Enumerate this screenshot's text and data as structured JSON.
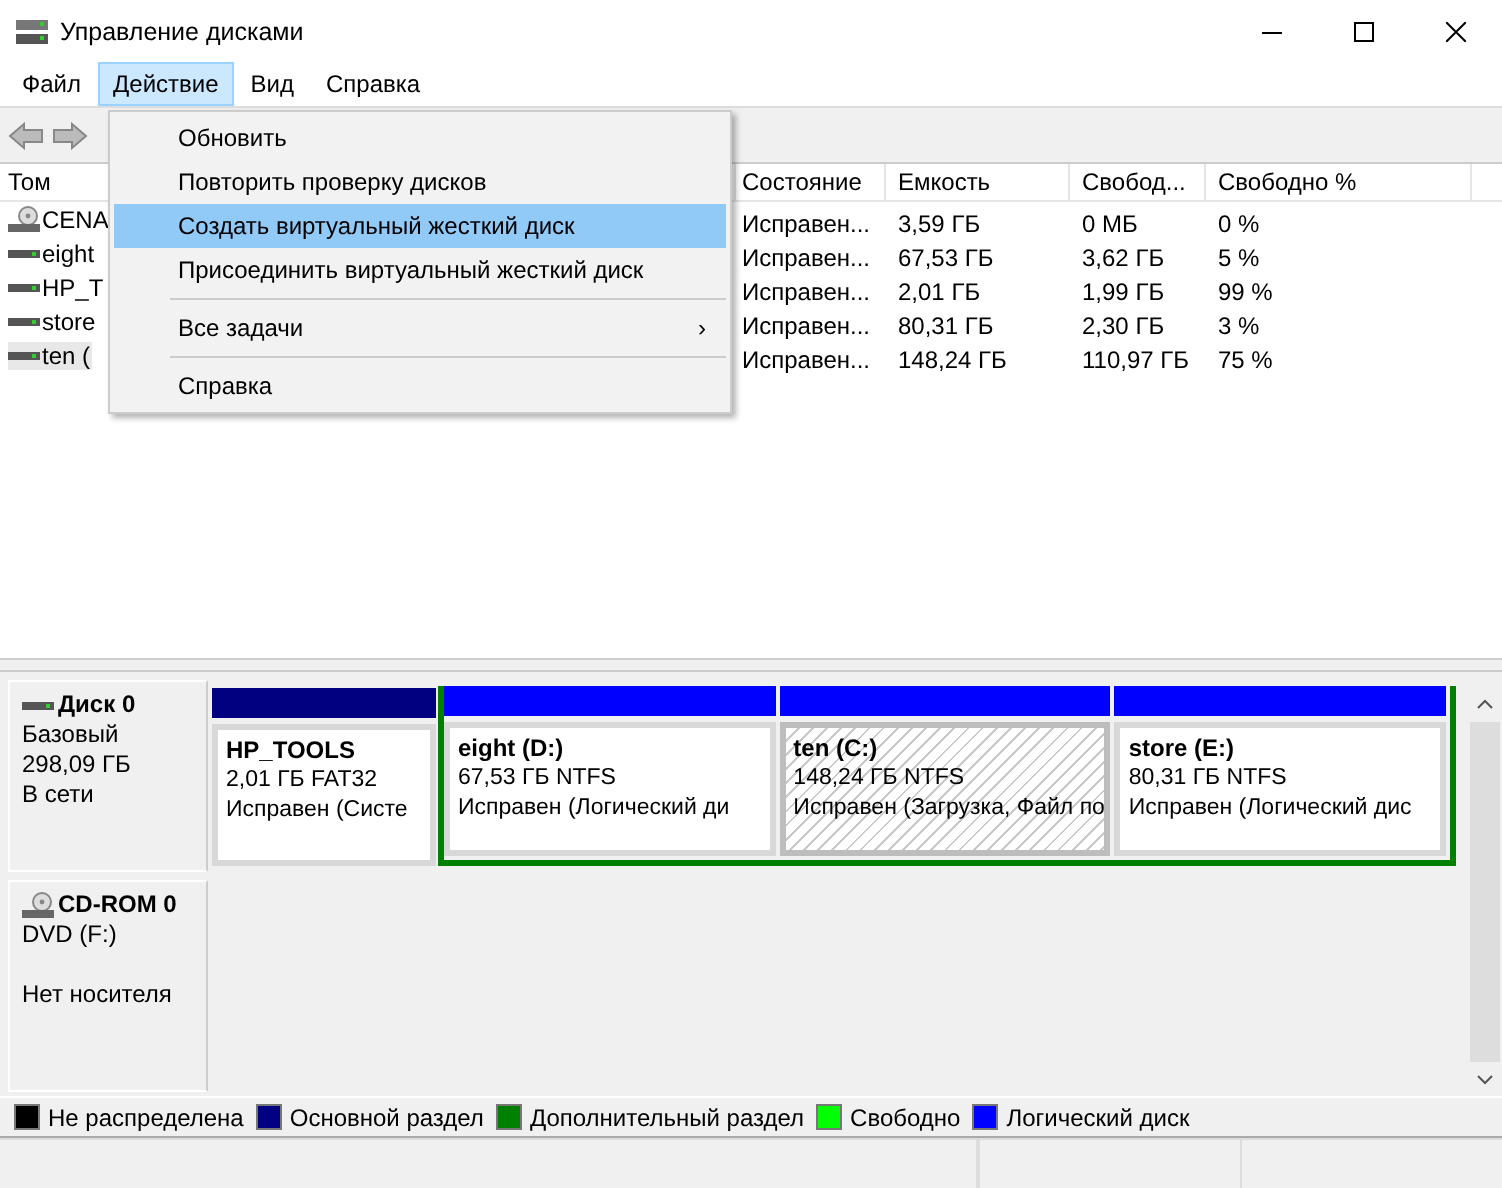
{
  "window": {
    "title": "Управление дисками"
  },
  "menubar": [
    {
      "label": "Файл",
      "selected": false
    },
    {
      "label": "Действие",
      "selected": true
    },
    {
      "label": "Вид",
      "selected": false
    },
    {
      "label": "Справка",
      "selected": false
    }
  ],
  "dropdown": {
    "groups": [
      [
        {
          "label": "Обновить",
          "selected": false
        },
        {
          "label": "Повторить проверку дисков",
          "selected": false
        },
        {
          "label": "Создать виртуальный жесткий диск",
          "selected": true
        },
        {
          "label": "Присоединить виртуальный жесткий диск",
          "selected": false
        }
      ],
      [
        {
          "label": "Все задачи",
          "selected": false,
          "arrow": "›"
        }
      ],
      [
        {
          "label": "Справка",
          "selected": false
        }
      ]
    ]
  },
  "volume_table": {
    "columns": [
      "Том",
      "Состояние",
      "Емкость",
      "Свобод...",
      "Свободно %"
    ],
    "rows": [
      {
        "kind": "cd",
        "name": "CENA",
        "status": "Исправен...",
        "capacity": "3,59 ГБ",
        "free": "0 МБ",
        "free_pct": "0 %",
        "selected": false
      },
      {
        "kind": "drive",
        "name": "eight",
        "status": "Исправен...",
        "capacity": "67,53 ГБ",
        "free": "3,62 ГБ",
        "free_pct": "5 %",
        "selected": false
      },
      {
        "kind": "drive",
        "name": "HP_T",
        "status": "Исправен...",
        "capacity": "2,01 ГБ",
        "free": "1,99 ГБ",
        "free_pct": "99 %",
        "selected": false
      },
      {
        "kind": "drive",
        "name": "store",
        "status": "Исправен...",
        "capacity": "80,31 ГБ",
        "free": "2,30 ГБ",
        "free_pct": "3 %",
        "selected": false
      },
      {
        "kind": "drive",
        "name": "ten (",
        "status": "Исправен...",
        "capacity": "148,24 ГБ",
        "free": "110,97 ГБ",
        "free_pct": "75 %",
        "selected": true
      }
    ]
  },
  "disks": [
    {
      "kind": "disk",
      "name": "Диск 0",
      "lines": [
        "Базовый",
        "298,09 ГБ",
        "В сети"
      ],
      "partitions": [
        {
          "kind": "primary",
          "name": "HP_TOOLS",
          "info": "2,01 ГБ FAT32",
          "status": "Исправен (Систе",
          "selected": false
        },
        {
          "kind": "extended",
          "children": [
            {
              "kind": "logical",
              "name": "eight  (D:)",
              "info": "67,53 ГБ NTFS",
              "status": "Исправен (Логический ди",
              "selected": false
            },
            {
              "kind": "logical",
              "name": "ten  (C:)",
              "info": "148,24 ГБ NTFS",
              "status": "Исправен (Загрузка, Файл по",
              "selected": true
            },
            {
              "kind": "logical",
              "name": "store  (E:)",
              "info": "80,31 ГБ NTFS",
              "status": "Исправен (Логический дис",
              "selected": false
            }
          ]
        }
      ]
    },
    {
      "kind": "cdrom",
      "name": "CD-ROM 0",
      "lines": [
        "DVD (F:)",
        "Нет носителя"
      ]
    }
  ],
  "legend": [
    {
      "label": "Не распределена",
      "color": "#000000"
    },
    {
      "label": "Основной раздел",
      "color": "#000080"
    },
    {
      "label": "Дополнительный раздел",
      "color": "#008000"
    },
    {
      "label": "Свободно",
      "color": "#00ff00"
    },
    {
      "label": "Логический диск",
      "color": "#0000ff"
    }
  ]
}
